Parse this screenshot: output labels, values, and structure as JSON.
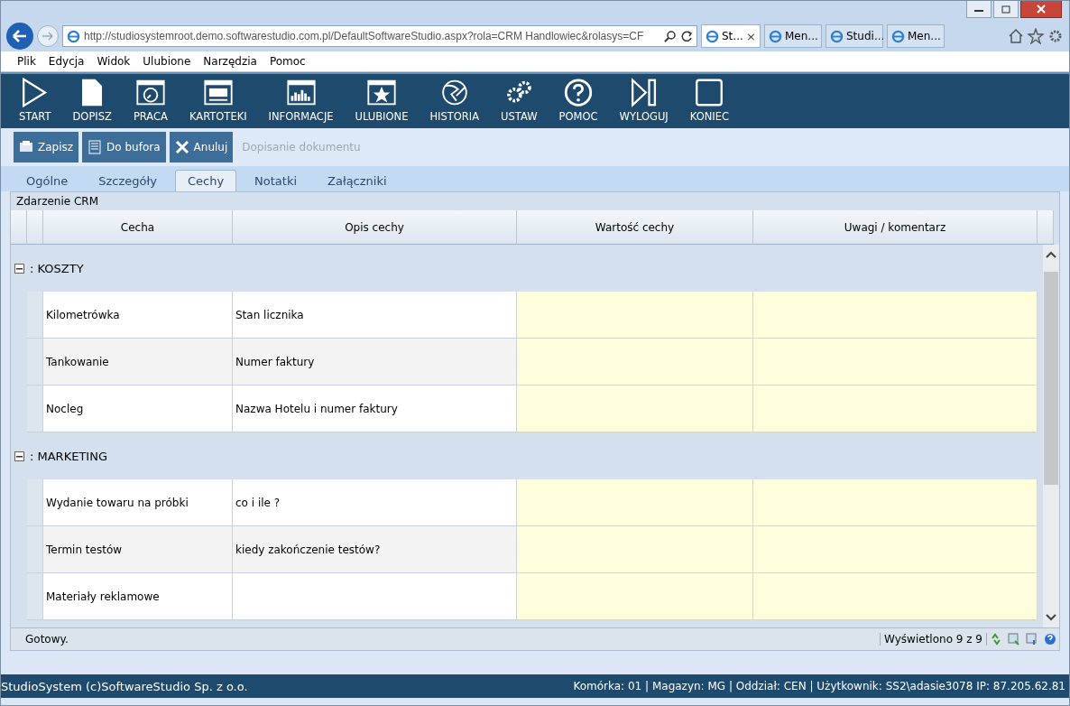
{
  "browser": {
    "address": "http://studiosystemroot.demo.softwarestudio.com.pl/DefaultSoftwareStudio.aspx?rola=CRM Handlowiec&rolasys=CF",
    "tabs": [
      {
        "label": "St...",
        "selected": true,
        "close": "×"
      },
      {
        "label": "Men...",
        "selected": false
      },
      {
        "label": "Studi...",
        "selected": false
      },
      {
        "label": "Men...",
        "selected": false
      }
    ],
    "menu": [
      "Plik",
      "Edycja",
      "Widok",
      "Ulubione",
      "Narzędzia",
      "Pomoc"
    ]
  },
  "toolbar": [
    {
      "label": "START",
      "kind": "play"
    },
    {
      "label": "DOPISZ",
      "kind": "page"
    },
    {
      "label": "PRACA",
      "kind": "clock"
    },
    {
      "label": "KARTOTEKI",
      "kind": "window"
    },
    {
      "label": "INFORMACJE",
      "kind": "chart"
    },
    {
      "label": "ULUBIONE",
      "kind": "star"
    },
    {
      "label": "HISTORIA",
      "kind": "globe"
    },
    {
      "label": "USTAW",
      "kind": "gears"
    },
    {
      "label": "POMOC",
      "kind": "help"
    },
    {
      "label": "WYLOGUJ",
      "kind": "skip"
    },
    {
      "label": "KONIEC",
      "kind": "square"
    }
  ],
  "actions": [
    {
      "label": "Zapisz",
      "kind": "save"
    },
    {
      "label": "Do bufora",
      "kind": "list"
    },
    {
      "label": "Anuluj",
      "kind": "cancel"
    }
  ],
  "action_caption": "Dopisanie dokumentu",
  "tabs": [
    {
      "label": "Ogólne",
      "selected": false
    },
    {
      "label": "Szczegóły",
      "selected": false
    },
    {
      "label": "Cechy",
      "selected": true
    },
    {
      "label": "Notatki",
      "selected": false
    },
    {
      "label": "Załączniki",
      "selected": false
    }
  ],
  "panel_title": "Zdarzenie CRM",
  "table": {
    "columns": [
      "Cecha",
      "Opis cechy",
      "Wartość cechy",
      "Uwagi / komentarz"
    ],
    "groups": [
      {
        "label": ": KOSZTY",
        "expanded": true,
        "rows": [
          {
            "feature": "Kilometrówka",
            "description": "Stan licznika"
          },
          {
            "feature": "Tankowanie",
            "description": "Numer faktury"
          },
          {
            "feature": "Nocleg",
            "description": "Nazwa Hotelu i numer faktury"
          }
        ]
      },
      {
        "label": ": MARKETING",
        "expanded": true,
        "rows": [
          {
            "feature": "Wydanie towaru na próbki",
            "description": "co i ile ?"
          },
          {
            "feature": "Termin testów",
            "description": "kiedy zakończenie testów?"
          },
          {
            "feature": "Materiały reklamowe",
            "description": ""
          }
        ]
      }
    ]
  },
  "status": {
    "text": "Gotowy.",
    "count": "Wyświetlono 9 z 9"
  },
  "footer": {
    "left": "StudioSystem (c)SoftwareStudio Sp. z o.o.",
    "right": "Komórka: 01 | Magazyn: MG | Oddział: CEN | Użytkownik: SS2\\adasie3078 IP: 87.205.62.81"
  }
}
